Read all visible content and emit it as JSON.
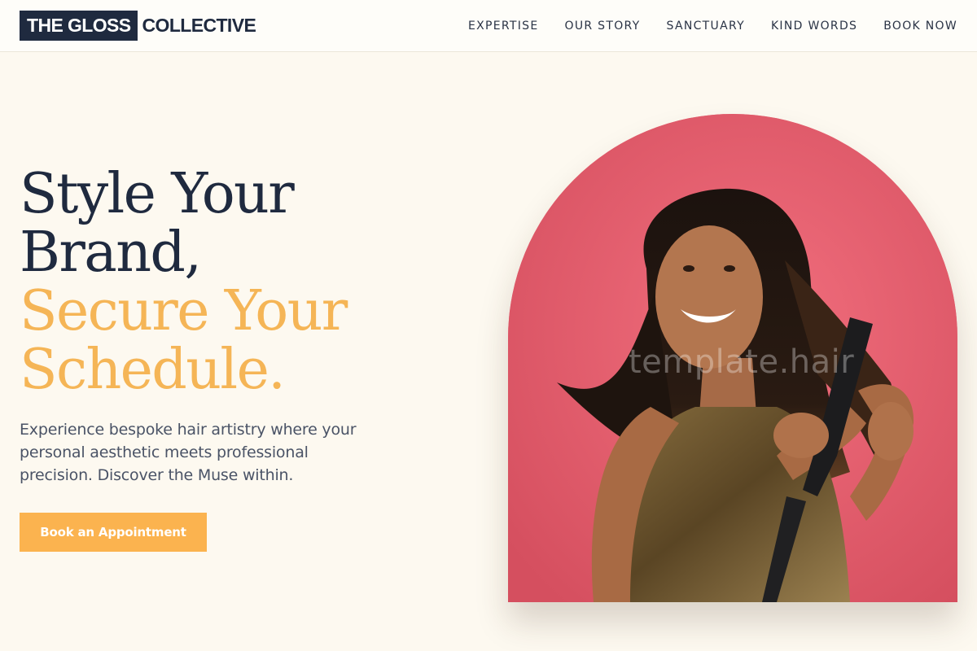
{
  "header": {
    "logo_boxed": "THE GLOSS",
    "logo_text": "COLLECTIVE",
    "nav": [
      "EXPERTISE",
      "OUR STORY",
      "SANCTUARY",
      "KIND WORDS",
      "BOOK NOW"
    ]
  },
  "hero": {
    "headline_dark": [
      "Style Your",
      "Brand,"
    ],
    "headline_accent": [
      "Secure Your",
      "Schedule."
    ],
    "lead": "Experience bespoke hair artistry where your personal aesthetic meets professional precision. Discover the Muse within.",
    "cta_label": "Book an Appointment",
    "image_watermark": "template.hair"
  },
  "colors": {
    "primary": "#1f2a3f",
    "accent": "#f5b556",
    "button": "#fbb34f",
    "background": "#fdf9f0",
    "image_backdrop": "#ec6474"
  }
}
